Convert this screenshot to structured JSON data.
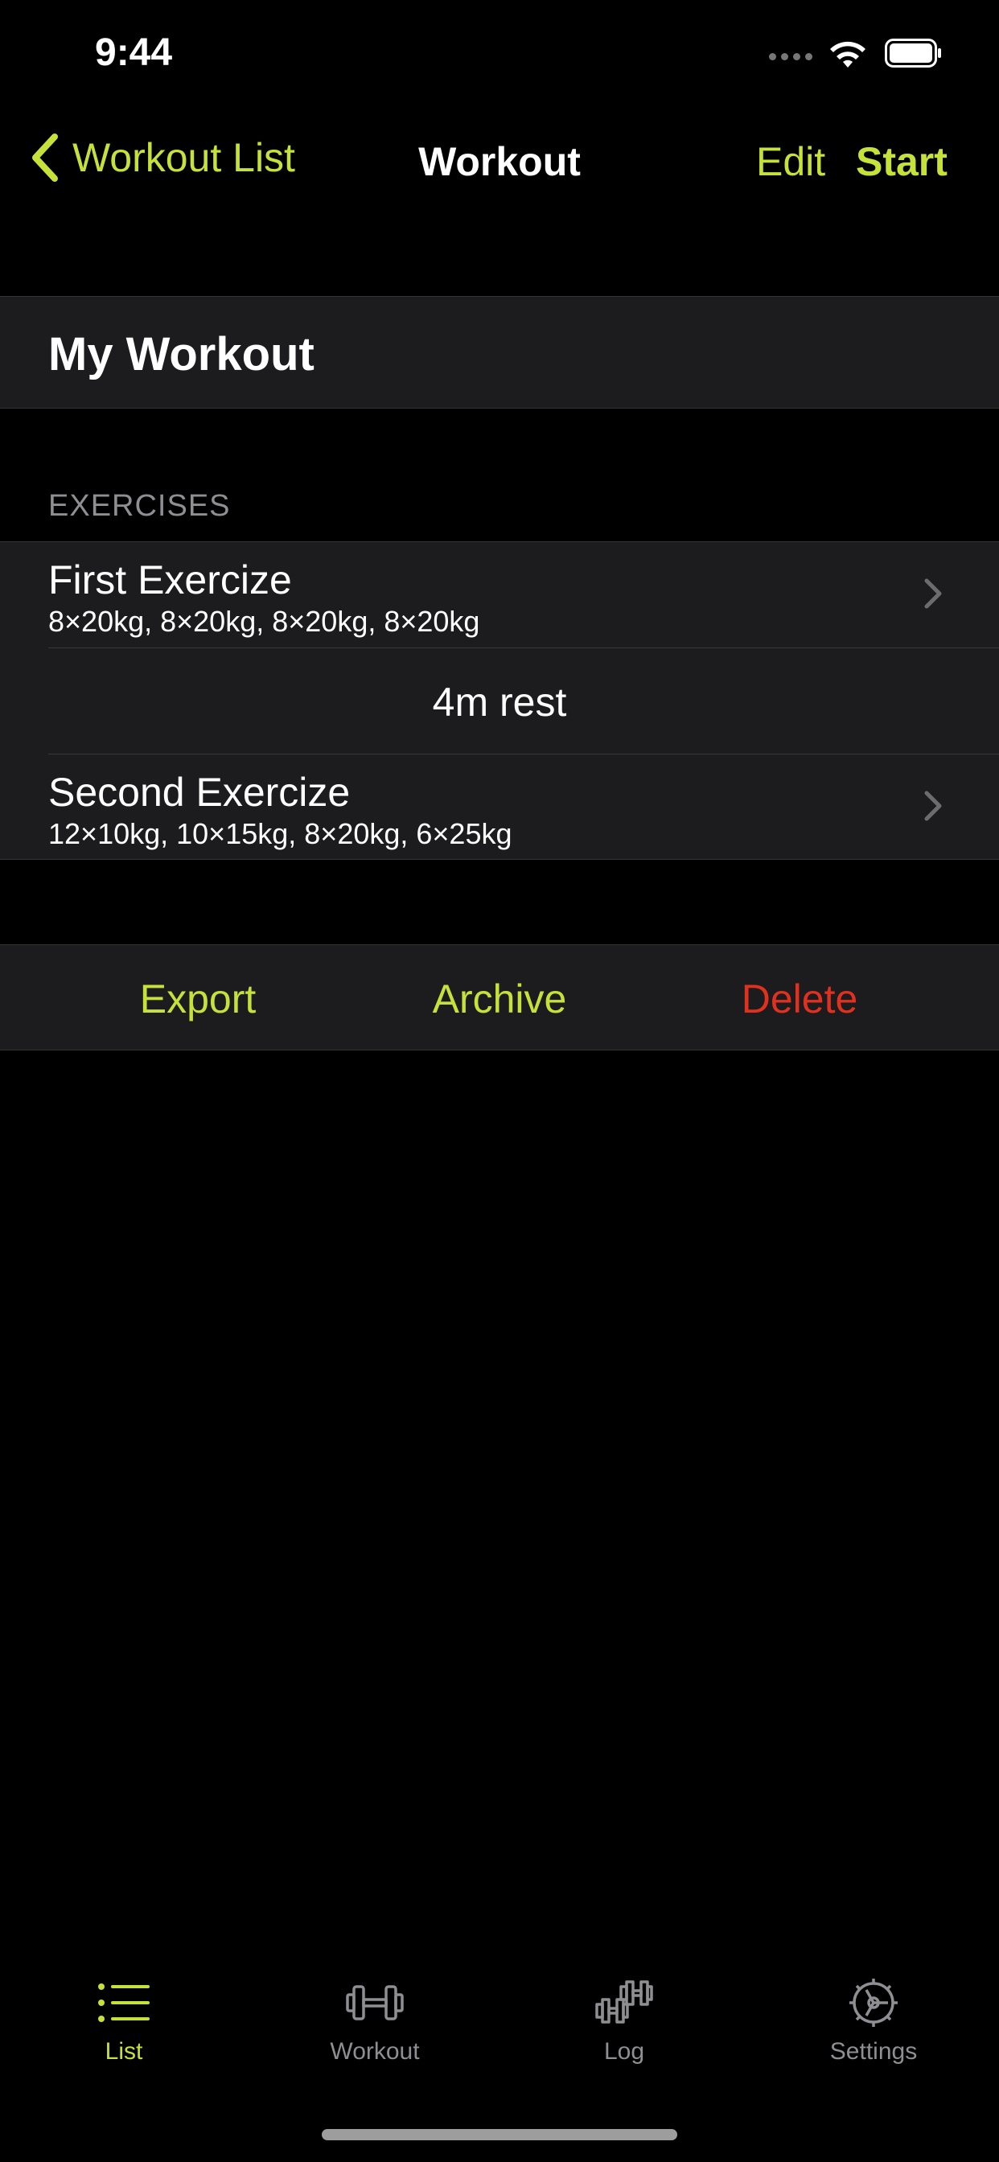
{
  "status_bar": {
    "time": "9:44"
  },
  "nav": {
    "back_label": "Workout List",
    "title": "Workout",
    "edit_label": "Edit",
    "start_label": "Start"
  },
  "workout": {
    "name": "My Workout"
  },
  "exercises_section": {
    "header": "EXERCISES",
    "items": [
      {
        "name": "First Exercize",
        "sets": "8×20kg, 8×20kg, 8×20kg, 8×20kg"
      },
      {
        "rest": "4m rest"
      },
      {
        "name": "Second Exercize",
        "sets": "12×10kg, 10×15kg, 8×20kg, 6×25kg"
      }
    ]
  },
  "actions": {
    "export_label": "Export",
    "archive_label": "Archive",
    "delete_label": "Delete"
  },
  "tabbar": {
    "items": [
      {
        "label": "List",
        "icon": "list-icon",
        "selected": true
      },
      {
        "label": "Workout",
        "icon": "dumbbell-icon",
        "selected": false
      },
      {
        "label": "Log",
        "icon": "log-dumbbells-icon",
        "selected": false
      },
      {
        "label": "Settings",
        "icon": "gear-icon",
        "selected": false
      }
    ]
  },
  "colors": {
    "accent": "#c6e13a",
    "destructive": "#e0301e",
    "background": "#000000",
    "cell": "#1c1c1e",
    "secondary_text": "#8e8e93"
  }
}
